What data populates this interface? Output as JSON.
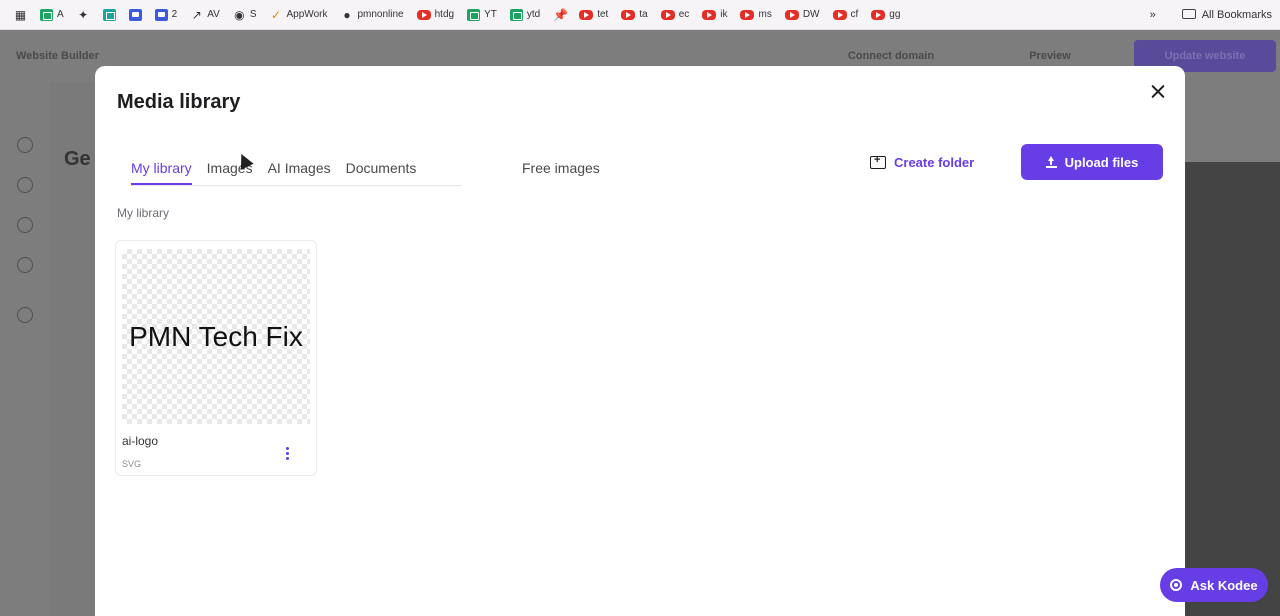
{
  "bookmarks_bar": {
    "items": [
      {
        "label": "A",
        "icon": "sheets-icon"
      },
      {
        "label": "",
        "icon": "puzzle-icon"
      },
      {
        "label": "",
        "icon": "teal-app-icon"
      },
      {
        "label": "",
        "icon": "chat-icon"
      },
      {
        "label": "2",
        "icon": "chat-icon"
      },
      {
        "label": "AV",
        "icon": "trend-icon"
      },
      {
        "label": "S",
        "icon": "globe-icon"
      },
      {
        "label": "AppWork",
        "icon": "check-icon"
      },
      {
        "label": "pmnonline",
        "icon": "github-icon"
      },
      {
        "label": "htdg",
        "icon": "youtube-icon"
      },
      {
        "label": "YT",
        "icon": "sheets-icon"
      },
      {
        "label": "ytd",
        "icon": "sheets-icon"
      },
      {
        "label": "",
        "icon": "pin-icon"
      },
      {
        "label": "tet",
        "icon": "youtube-icon"
      },
      {
        "label": "ta",
        "icon": "youtube-icon"
      },
      {
        "label": "ec",
        "icon": "youtube-icon"
      },
      {
        "label": "ik",
        "icon": "youtube-icon"
      },
      {
        "label": "ms",
        "icon": "youtube-icon"
      },
      {
        "label": "DW",
        "icon": "youtube-icon"
      },
      {
        "label": "cf",
        "icon": "youtube-icon"
      },
      {
        "label": "gg",
        "icon": "youtube-icon"
      }
    ],
    "more": "»",
    "all_bookmarks": "All Bookmarks"
  },
  "background_app": {
    "title": "Website Builder",
    "connect_domain": "Connect domain",
    "preview": "Preview",
    "update": "Update website",
    "page_heading": "Ge"
  },
  "modal": {
    "title": "Media library",
    "tabs": [
      {
        "label": "My library",
        "active": true
      },
      {
        "label": "Images",
        "active": false
      },
      {
        "label": "AI Images",
        "active": false
      },
      {
        "label": "Documents",
        "active": false
      }
    ],
    "free_images_tab": "Free images",
    "create_folder": "Create folder",
    "upload_files": "Upload files",
    "breadcrumb": "My library",
    "files": [
      {
        "name": "ai-logo",
        "type": "SVG",
        "preview_text": "PMN Tech Fix"
      }
    ]
  },
  "ask_button": "Ask Kodee",
  "colors": {
    "accent": "#673de6",
    "overlay": "#7a7a7a",
    "text": "#1d1e20"
  }
}
